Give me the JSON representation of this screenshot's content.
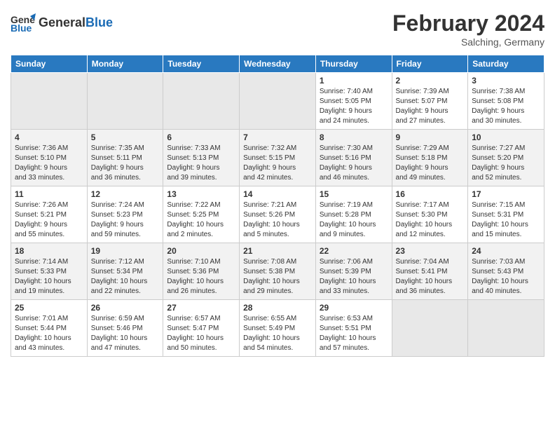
{
  "header": {
    "logo_general": "General",
    "logo_blue": "Blue",
    "title": "February 2024",
    "subtitle": "Salching, Germany"
  },
  "weekdays": [
    "Sunday",
    "Monday",
    "Tuesday",
    "Wednesday",
    "Thursday",
    "Friday",
    "Saturday"
  ],
  "weeks": [
    [
      {
        "day": "",
        "info": ""
      },
      {
        "day": "",
        "info": ""
      },
      {
        "day": "",
        "info": ""
      },
      {
        "day": "",
        "info": ""
      },
      {
        "day": "1",
        "info": "Sunrise: 7:40 AM\nSunset: 5:05 PM\nDaylight: 9 hours\nand 24 minutes."
      },
      {
        "day": "2",
        "info": "Sunrise: 7:39 AM\nSunset: 5:07 PM\nDaylight: 9 hours\nand 27 minutes."
      },
      {
        "day": "3",
        "info": "Sunrise: 7:38 AM\nSunset: 5:08 PM\nDaylight: 9 hours\nand 30 minutes."
      }
    ],
    [
      {
        "day": "4",
        "info": "Sunrise: 7:36 AM\nSunset: 5:10 PM\nDaylight: 9 hours\nand 33 minutes."
      },
      {
        "day": "5",
        "info": "Sunrise: 7:35 AM\nSunset: 5:11 PM\nDaylight: 9 hours\nand 36 minutes."
      },
      {
        "day": "6",
        "info": "Sunrise: 7:33 AM\nSunset: 5:13 PM\nDaylight: 9 hours\nand 39 minutes."
      },
      {
        "day": "7",
        "info": "Sunrise: 7:32 AM\nSunset: 5:15 PM\nDaylight: 9 hours\nand 42 minutes."
      },
      {
        "day": "8",
        "info": "Sunrise: 7:30 AM\nSunset: 5:16 PM\nDaylight: 9 hours\nand 46 minutes."
      },
      {
        "day": "9",
        "info": "Sunrise: 7:29 AM\nSunset: 5:18 PM\nDaylight: 9 hours\nand 49 minutes."
      },
      {
        "day": "10",
        "info": "Sunrise: 7:27 AM\nSunset: 5:20 PM\nDaylight: 9 hours\nand 52 minutes."
      }
    ],
    [
      {
        "day": "11",
        "info": "Sunrise: 7:26 AM\nSunset: 5:21 PM\nDaylight: 9 hours\nand 55 minutes."
      },
      {
        "day": "12",
        "info": "Sunrise: 7:24 AM\nSunset: 5:23 PM\nDaylight: 9 hours\nand 59 minutes."
      },
      {
        "day": "13",
        "info": "Sunrise: 7:22 AM\nSunset: 5:25 PM\nDaylight: 10 hours\nand 2 minutes."
      },
      {
        "day": "14",
        "info": "Sunrise: 7:21 AM\nSunset: 5:26 PM\nDaylight: 10 hours\nand 5 minutes."
      },
      {
        "day": "15",
        "info": "Sunrise: 7:19 AM\nSunset: 5:28 PM\nDaylight: 10 hours\nand 9 minutes."
      },
      {
        "day": "16",
        "info": "Sunrise: 7:17 AM\nSunset: 5:30 PM\nDaylight: 10 hours\nand 12 minutes."
      },
      {
        "day": "17",
        "info": "Sunrise: 7:15 AM\nSunset: 5:31 PM\nDaylight: 10 hours\nand 15 minutes."
      }
    ],
    [
      {
        "day": "18",
        "info": "Sunrise: 7:14 AM\nSunset: 5:33 PM\nDaylight: 10 hours\nand 19 minutes."
      },
      {
        "day": "19",
        "info": "Sunrise: 7:12 AM\nSunset: 5:34 PM\nDaylight: 10 hours\nand 22 minutes."
      },
      {
        "day": "20",
        "info": "Sunrise: 7:10 AM\nSunset: 5:36 PM\nDaylight: 10 hours\nand 26 minutes."
      },
      {
        "day": "21",
        "info": "Sunrise: 7:08 AM\nSunset: 5:38 PM\nDaylight: 10 hours\nand 29 minutes."
      },
      {
        "day": "22",
        "info": "Sunrise: 7:06 AM\nSunset: 5:39 PM\nDaylight: 10 hours\nand 33 minutes."
      },
      {
        "day": "23",
        "info": "Sunrise: 7:04 AM\nSunset: 5:41 PM\nDaylight: 10 hours\nand 36 minutes."
      },
      {
        "day": "24",
        "info": "Sunrise: 7:03 AM\nSunset: 5:43 PM\nDaylight: 10 hours\nand 40 minutes."
      }
    ],
    [
      {
        "day": "25",
        "info": "Sunrise: 7:01 AM\nSunset: 5:44 PM\nDaylight: 10 hours\nand 43 minutes."
      },
      {
        "day": "26",
        "info": "Sunrise: 6:59 AM\nSunset: 5:46 PM\nDaylight: 10 hours\nand 47 minutes."
      },
      {
        "day": "27",
        "info": "Sunrise: 6:57 AM\nSunset: 5:47 PM\nDaylight: 10 hours\nand 50 minutes."
      },
      {
        "day": "28",
        "info": "Sunrise: 6:55 AM\nSunset: 5:49 PM\nDaylight: 10 hours\nand 54 minutes."
      },
      {
        "day": "29",
        "info": "Sunrise: 6:53 AM\nSunset: 5:51 PM\nDaylight: 10 hours\nand 57 minutes."
      },
      {
        "day": "",
        "info": ""
      },
      {
        "day": "",
        "info": ""
      }
    ]
  ]
}
